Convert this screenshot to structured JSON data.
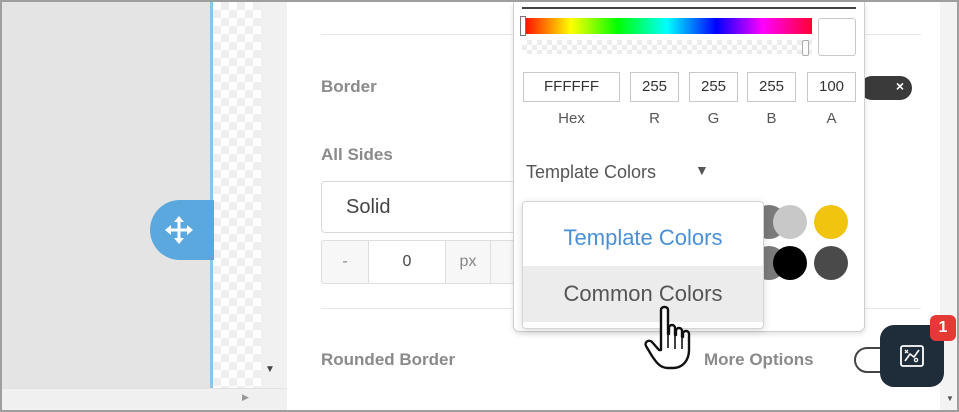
{
  "canvas": {
    "move_handle": "move-icon"
  },
  "settings": {
    "border_label": "Border",
    "all_sides_label": "All Sides",
    "border_style_value": "Solid",
    "border_width": {
      "minus": "-",
      "value": "0",
      "unit": "px"
    },
    "rounded_border_label": "Rounded Border",
    "more_options_label": "More Options",
    "border_toggle_icon": "close-icon",
    "border_toggle_glyph": "×"
  },
  "color_picker": {
    "hex_value": "FFFFFF",
    "r_value": "255",
    "g_value": "255",
    "b_value": "255",
    "a_value": "100",
    "hex_label": "Hex",
    "r_label": "R",
    "g_label": "G",
    "b_label": "B",
    "a_label": "A",
    "preview_color": "#FFFFFF",
    "palette_select_label": "Template Colors",
    "palette_caret": "▼",
    "palette_swatches": [
      "#C8C8C8",
      "#F1C40F",
      "#000000",
      "#4A4A4A"
    ],
    "dropdown_options": [
      "Template Colors",
      "Common Colors"
    ],
    "dropdown_selected": "Template Colors",
    "dropdown_hovered": "Common Colors"
  },
  "help": {
    "badge_count": "1",
    "icon": "strategy-board-icon"
  },
  "colors": {
    "accent": "#5BA8DE",
    "help_button": "#1F2D3A",
    "badge": "#E53935"
  }
}
